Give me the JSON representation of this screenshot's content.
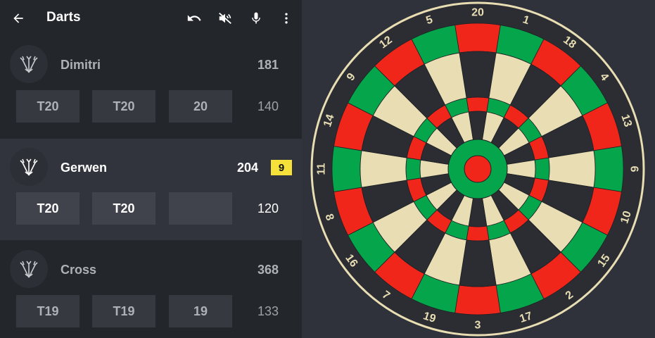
{
  "app": {
    "title": "Darts"
  },
  "icons": {
    "back": "arrow-left-icon",
    "undo": "undo-icon",
    "speech_off": "speaker-off-icon",
    "mic": "microphone-icon",
    "more": "more-vert-icon"
  },
  "players": [
    {
      "name": "Dimitri",
      "score": "181",
      "throws": [
        "T20",
        "T20",
        "20"
      ],
      "remaining": "140",
      "active": false,
      "badge": ""
    },
    {
      "name": "Gerwen",
      "score": "204",
      "throws": [
        "T20",
        "T20",
        ""
      ],
      "remaining": "120",
      "active": true,
      "badge": "9"
    },
    {
      "name": "Cross",
      "score": "368",
      "throws": [
        "T19",
        "T19",
        "19"
      ],
      "remaining": "133",
      "active": false,
      "badge": ""
    }
  ],
  "dartboard": {
    "numbers": [
      "20",
      "1",
      "18",
      "4",
      "13",
      "6",
      "10",
      "15",
      "2",
      "17",
      "3",
      "19",
      "7",
      "16",
      "8",
      "11",
      "14",
      "9",
      "12",
      "5"
    ],
    "colors": {
      "red": "#f0261b",
      "green": "#04a54b",
      "cream": "#e8ddb3",
      "black": "#2b2d32",
      "outer_ring": "#e8ddb3",
      "numbers": "#e8ddb3"
    }
  }
}
